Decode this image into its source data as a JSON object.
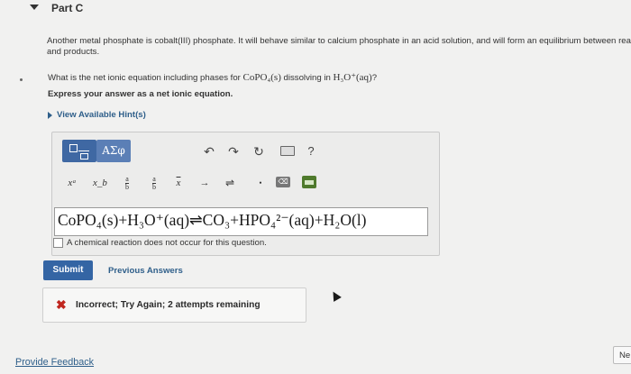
{
  "part": {
    "title": "Part C"
  },
  "intro": {
    "line1": "Another metal phosphate is cobalt(III) phosphate. It will behave similar to calcium phosphate in an acid solution, and will form an equilibrium between reac",
    "line2": "and products."
  },
  "question": {
    "prefix": "What is the net ionic equation including phases for ",
    "compound": "CoPO₄(s)",
    "middle": " dissolving in ",
    "solvent": "H₃O⁺(aq)",
    "suffix": "?"
  },
  "instruction": "Express your answer as a net ionic equation.",
  "hints_label": "View Available Hint(s)",
  "toolbar": {
    "greek_label": "ΑΣφ",
    "undo": "↶",
    "redo": "↷",
    "reset": "↻",
    "help": "?"
  },
  "keys": {
    "superscript": "xᵃ",
    "subscript": "x_b",
    "frac_top": "a",
    "frac_bottom": "b",
    "arrow": "→",
    "equilibrium": "⇌",
    "dot": "•"
  },
  "answer": {
    "text": "CoPO₄(s)+H₃O⁺(aq)⇌CO₃+HPO₄²⁻(aq)+H₂O(l)"
  },
  "no_reaction_label": "A chemical reaction does not occur for this question.",
  "buttons": {
    "submit": "Submit",
    "previous_answers": "Previous Answers",
    "next": "Ne"
  },
  "feedback": {
    "icon": "✖",
    "message": "Incorrect; Try Again; 2 attempts remaining",
    "status_color": "#c0271f"
  },
  "footer": {
    "provide_feedback": "Provide Feedback"
  }
}
